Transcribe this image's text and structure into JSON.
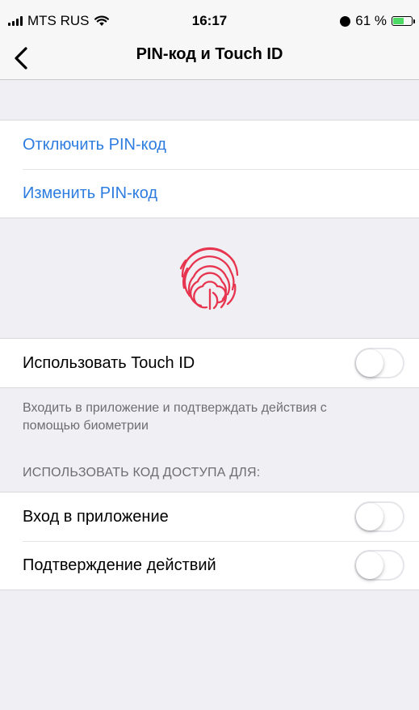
{
  "status_bar": {
    "carrier": "MTS RUS",
    "time": "16:17",
    "battery_percent": "61 %",
    "battery_level": 0.61
  },
  "nav": {
    "title": "PIN-код и Touch ID"
  },
  "pin_actions": [
    {
      "label": "Отключить PIN-код"
    },
    {
      "label": "Изменить PIN-код"
    }
  ],
  "touch_id": {
    "label": "Использовать Touch ID",
    "enabled": false,
    "description": "Входить в приложение и подтверждать действия с помощью биометрии"
  },
  "access_code": {
    "header": "ИСПОЛЬЗОВАТЬ КОД ДОСТУПА ДЛЯ:",
    "items": [
      {
        "label": "Вход в приложение",
        "enabled": false
      },
      {
        "label": "Подтверждение действий",
        "enabled": false
      }
    ]
  },
  "colors": {
    "link": "#2d7de0",
    "fingerprint": "#e8354f",
    "background": "#efeff4"
  }
}
